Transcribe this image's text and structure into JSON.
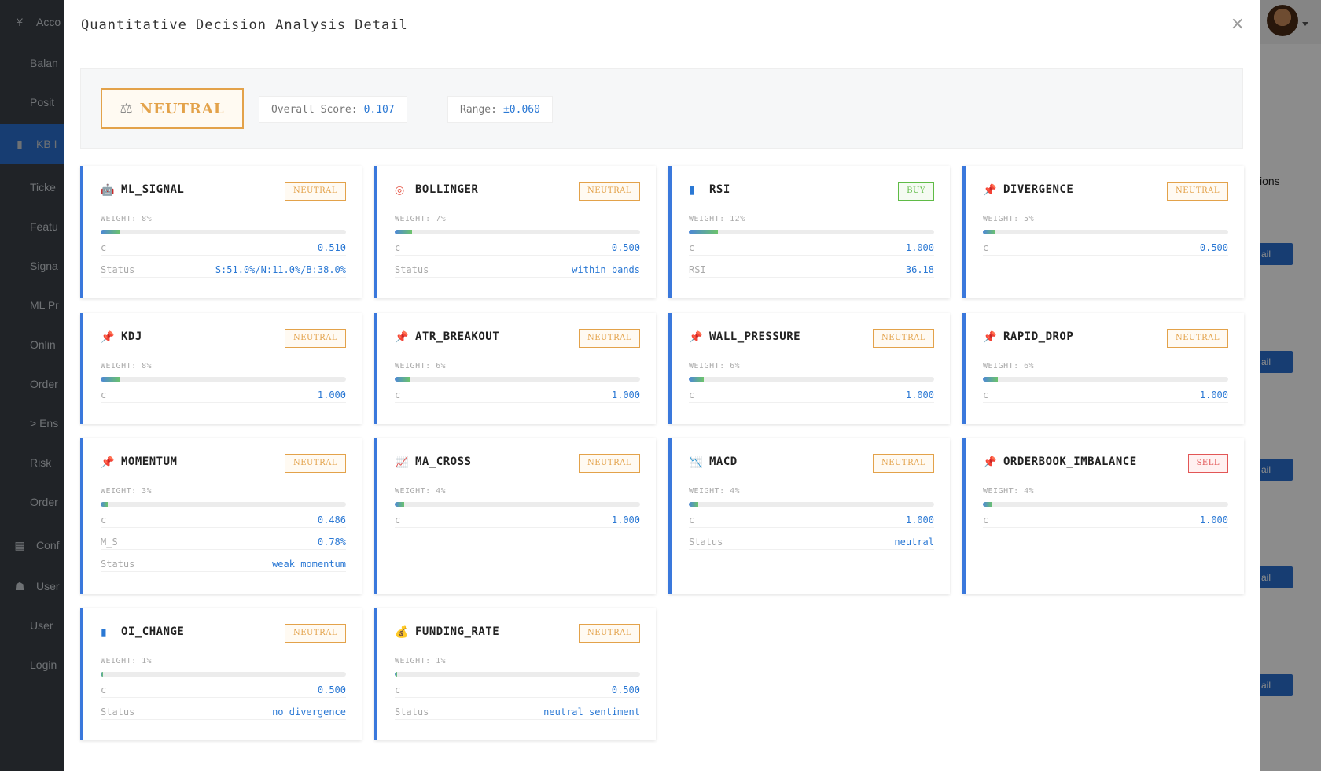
{
  "background": {
    "sidebar": [
      {
        "label": "Acco",
        "kind": "group",
        "icon": "yen-icon"
      },
      {
        "label": "Balan",
        "kind": "item"
      },
      {
        "label": "Posit",
        "kind": "item"
      },
      {
        "label": "KB I",
        "kind": "group-active",
        "icon": "bar-chart-icon"
      },
      {
        "label": "Ticke",
        "kind": "item"
      },
      {
        "label": "Featu",
        "kind": "item"
      },
      {
        "label": "Signa",
        "kind": "item"
      },
      {
        "label": "ML Pr",
        "kind": "item"
      },
      {
        "label": "Onlin",
        "kind": "item"
      },
      {
        "label": "Order",
        "kind": "item"
      },
      {
        "label": "> Ens",
        "kind": "item"
      },
      {
        "label": "Risk",
        "kind": "item"
      },
      {
        "label": "Order",
        "kind": "item"
      },
      {
        "label": "Conf",
        "kind": "group",
        "icon": "grid-icon"
      },
      {
        "label": "User",
        "kind": "group",
        "icon": "users-icon"
      },
      {
        "label": "User",
        "kind": "item"
      },
      {
        "label": "Login",
        "kind": "item"
      }
    ],
    "right_label": "ions",
    "right_buttons": [
      "ail",
      "ail",
      "ail",
      "ail",
      "ail"
    ]
  },
  "modal": {
    "title": "Quantitative Decision Analysis Detail",
    "close_glyph": "×",
    "decision": {
      "icon": "⚖",
      "label": "NEUTRAL"
    },
    "overall_score": {
      "label": "Overall Score:",
      "value": "0.107"
    },
    "range": {
      "label": "Range:",
      "value": "±0.060"
    }
  },
  "cards": [
    {
      "icon": "robot-icon",
      "glyph": "🤖",
      "name": "ML_SIGNAL",
      "signal": "NEUTRAL",
      "signal_kind": "neutral",
      "weight_label": "WEIGHT: 8%",
      "weight": 0.08,
      "rows": [
        {
          "k": "c",
          "v": "0.510"
        },
        {
          "k": "Status",
          "v": "S:51.0%/N:11.0%/B:38.0%"
        }
      ]
    },
    {
      "icon": "target-icon",
      "glyph": "◎",
      "name": "BOLLINGER",
      "signal": "NEUTRAL",
      "signal_kind": "neutral",
      "weight_label": "WEIGHT: 7%",
      "weight": 0.07,
      "rows": [
        {
          "k": "c",
          "v": "0.500"
        },
        {
          "k": "Status",
          "v": "within bands"
        }
      ]
    },
    {
      "icon": "bar-chart-icon",
      "glyph": "▮",
      "name": "RSI",
      "signal": "BUY",
      "signal_kind": "buy",
      "weight_label": "WEIGHT: 12%",
      "weight": 0.12,
      "rows": [
        {
          "k": "c",
          "v": "1.000"
        },
        {
          "k": "RSI",
          "v": "36.18"
        }
      ]
    },
    {
      "icon": "pushpin-icon",
      "glyph": "📌",
      "name": "DIVERGENCE",
      "signal": "NEUTRAL",
      "signal_kind": "neutral",
      "weight_label": "WEIGHT: 5%",
      "weight": 0.05,
      "rows": [
        {
          "k": "c",
          "v": "0.500"
        }
      ]
    },
    {
      "icon": "pushpin-icon",
      "glyph": "📌",
      "name": "KDJ",
      "signal": "NEUTRAL",
      "signal_kind": "neutral",
      "weight_label": "WEIGHT: 8%",
      "weight": 0.08,
      "rows": [
        {
          "k": "c",
          "v": "1.000"
        }
      ]
    },
    {
      "icon": "pushpin-icon",
      "glyph": "📌",
      "name": "ATR_BREAKOUT",
      "signal": "NEUTRAL",
      "signal_kind": "neutral",
      "weight_label": "WEIGHT: 6%",
      "weight": 0.06,
      "rows": [
        {
          "k": "c",
          "v": "1.000"
        }
      ]
    },
    {
      "icon": "pushpin-icon",
      "glyph": "📌",
      "name": "WALL_PRESSURE",
      "signal": "NEUTRAL",
      "signal_kind": "neutral",
      "weight_label": "WEIGHT: 6%",
      "weight": 0.06,
      "rows": [
        {
          "k": "c",
          "v": "1.000"
        }
      ]
    },
    {
      "icon": "pushpin-icon",
      "glyph": "📌",
      "name": "RAPID_DROP",
      "signal": "NEUTRAL",
      "signal_kind": "neutral",
      "weight_label": "WEIGHT: 6%",
      "weight": 0.06,
      "rows": [
        {
          "k": "c",
          "v": "1.000"
        }
      ]
    },
    {
      "icon": "pushpin-icon",
      "glyph": "📌",
      "name": "MOMENTUM",
      "signal": "NEUTRAL",
      "signal_kind": "neutral",
      "weight_label": "WEIGHT: 3%",
      "weight": 0.03,
      "rows": [
        {
          "k": "c",
          "v": "0.486"
        },
        {
          "k": "M_S",
          "v": "0.78%"
        },
        {
          "k": "Status",
          "v": "weak momentum"
        }
      ]
    },
    {
      "icon": "chart-up-icon",
      "glyph": "📈",
      "name": "MA_CROSS",
      "signal": "NEUTRAL",
      "signal_kind": "neutral",
      "weight_label": "WEIGHT: 4%",
      "weight": 0.04,
      "rows": [
        {
          "k": "c",
          "v": "1.000"
        }
      ]
    },
    {
      "icon": "chart-down-icon",
      "glyph": "📉",
      "name": "MACD",
      "signal": "NEUTRAL",
      "signal_kind": "neutral",
      "weight_label": "WEIGHT: 4%",
      "weight": 0.04,
      "rows": [
        {
          "k": "c",
          "v": "1.000"
        },
        {
          "k": "Status",
          "v": "neutral"
        }
      ]
    },
    {
      "icon": "pushpin-icon",
      "glyph": "📌",
      "name": "ORDERBOOK_IMBALANCE",
      "signal": "SELL",
      "signal_kind": "sell",
      "weight_label": "WEIGHT: 4%",
      "weight": 0.04,
      "rows": [
        {
          "k": "c",
          "v": "1.000"
        }
      ]
    },
    {
      "icon": "bar-chart-icon",
      "glyph": "▮",
      "name": "OI_CHANGE",
      "signal": "NEUTRAL",
      "signal_kind": "neutral",
      "weight_label": "WEIGHT: 1%",
      "weight": 0.01,
      "rows": [
        {
          "k": "c",
          "v": "0.500"
        },
        {
          "k": "Status",
          "v": "no divergence"
        }
      ]
    },
    {
      "icon": "money-bag-icon",
      "glyph": "💰",
      "name": "FUNDING_RATE",
      "signal": "NEUTRAL",
      "signal_kind": "neutral",
      "weight_label": "WEIGHT: 1%",
      "weight": 0.01,
      "rows": [
        {
          "k": "c",
          "v": "0.500"
        },
        {
          "k": "Status",
          "v": "neutral sentiment"
        }
      ]
    }
  ]
}
